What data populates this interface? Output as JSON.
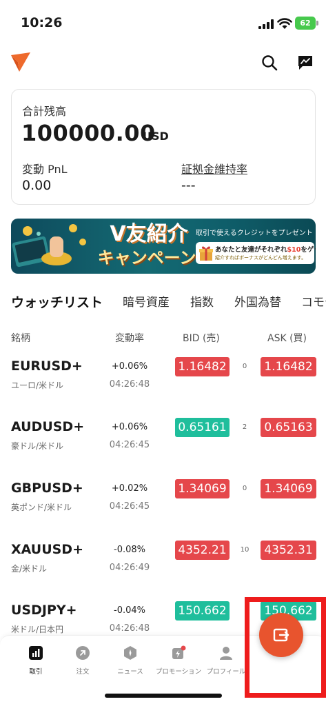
{
  "status_bar": {
    "time": "10:26",
    "battery": "62"
  },
  "balance": {
    "label": "合計残高",
    "value": "100000.00",
    "currency": "USD",
    "pnl_label": "変動 PnL",
    "pnl_value": "0.00",
    "margin_label": "証拠金維持率",
    "margin_value": "---"
  },
  "banner": {
    "title": "V友紹介",
    "title2": "キャンペーン",
    "sub": "取引で使えるクレジットをプレゼント",
    "gift_text_a": "あなたと友達がそれぞれ",
    "gift_amount": "$10",
    "gift_text_b": "をゲット!",
    "gift_small": "紹介すればボーナスがどんどん増えます。"
  },
  "tabs": [
    "ウォッチリスト",
    "暗号資産",
    "指数",
    "外国為替",
    "コモディ"
  ],
  "columns": {
    "symbol": "銘柄",
    "change": "変動率",
    "bid": "BID (売)",
    "ask": "ASK (買)"
  },
  "rows": [
    {
      "symbol": "EURUSD+",
      "name": "ユーロ/米ドル",
      "change": "+0.06%",
      "time": "04:26:48",
      "bid": "1.16482",
      "bid_color": "red",
      "spread": "0",
      "ask": "1.16482",
      "ask_color": "red"
    },
    {
      "symbol": "AUDUSD+",
      "name": "豪ドル/米ドル",
      "change": "+0.06%",
      "time": "04:26:45",
      "bid": "0.65161",
      "bid_color": "green",
      "spread": "2",
      "ask": "0.65163",
      "ask_color": "red"
    },
    {
      "symbol": "GBPUSD+",
      "name": "英ポンド/米ドル",
      "change": "+0.02%",
      "time": "04:26:45",
      "bid": "1.34069",
      "bid_color": "red",
      "spread": "0",
      "ask": "1.34069",
      "ask_color": "red"
    },
    {
      "symbol": "XAUUSD+",
      "name": "金/米ドル",
      "change": "-0.08%",
      "time": "04:26:49",
      "bid": "4352.21",
      "bid_color": "red",
      "spread": "10",
      "ask": "4352.31",
      "ask_color": "red"
    },
    {
      "symbol": "USDJPY+",
      "name": "米ドル/日本円",
      "change": "-0.04%",
      "time": "04:26:48",
      "bid": "150.662",
      "bid_color": "green",
      "spread": "",
      "ask": "150.662",
      "ask_color": "green"
    }
  ],
  "nav": [
    "取引",
    "注文",
    "ニュース",
    "プロモーション",
    "プロフィール"
  ],
  "colors": {
    "accent": "#e8542e",
    "up": "#1fbe9c",
    "down": "#e5474b",
    "highlight": "#ee1c1c"
  }
}
